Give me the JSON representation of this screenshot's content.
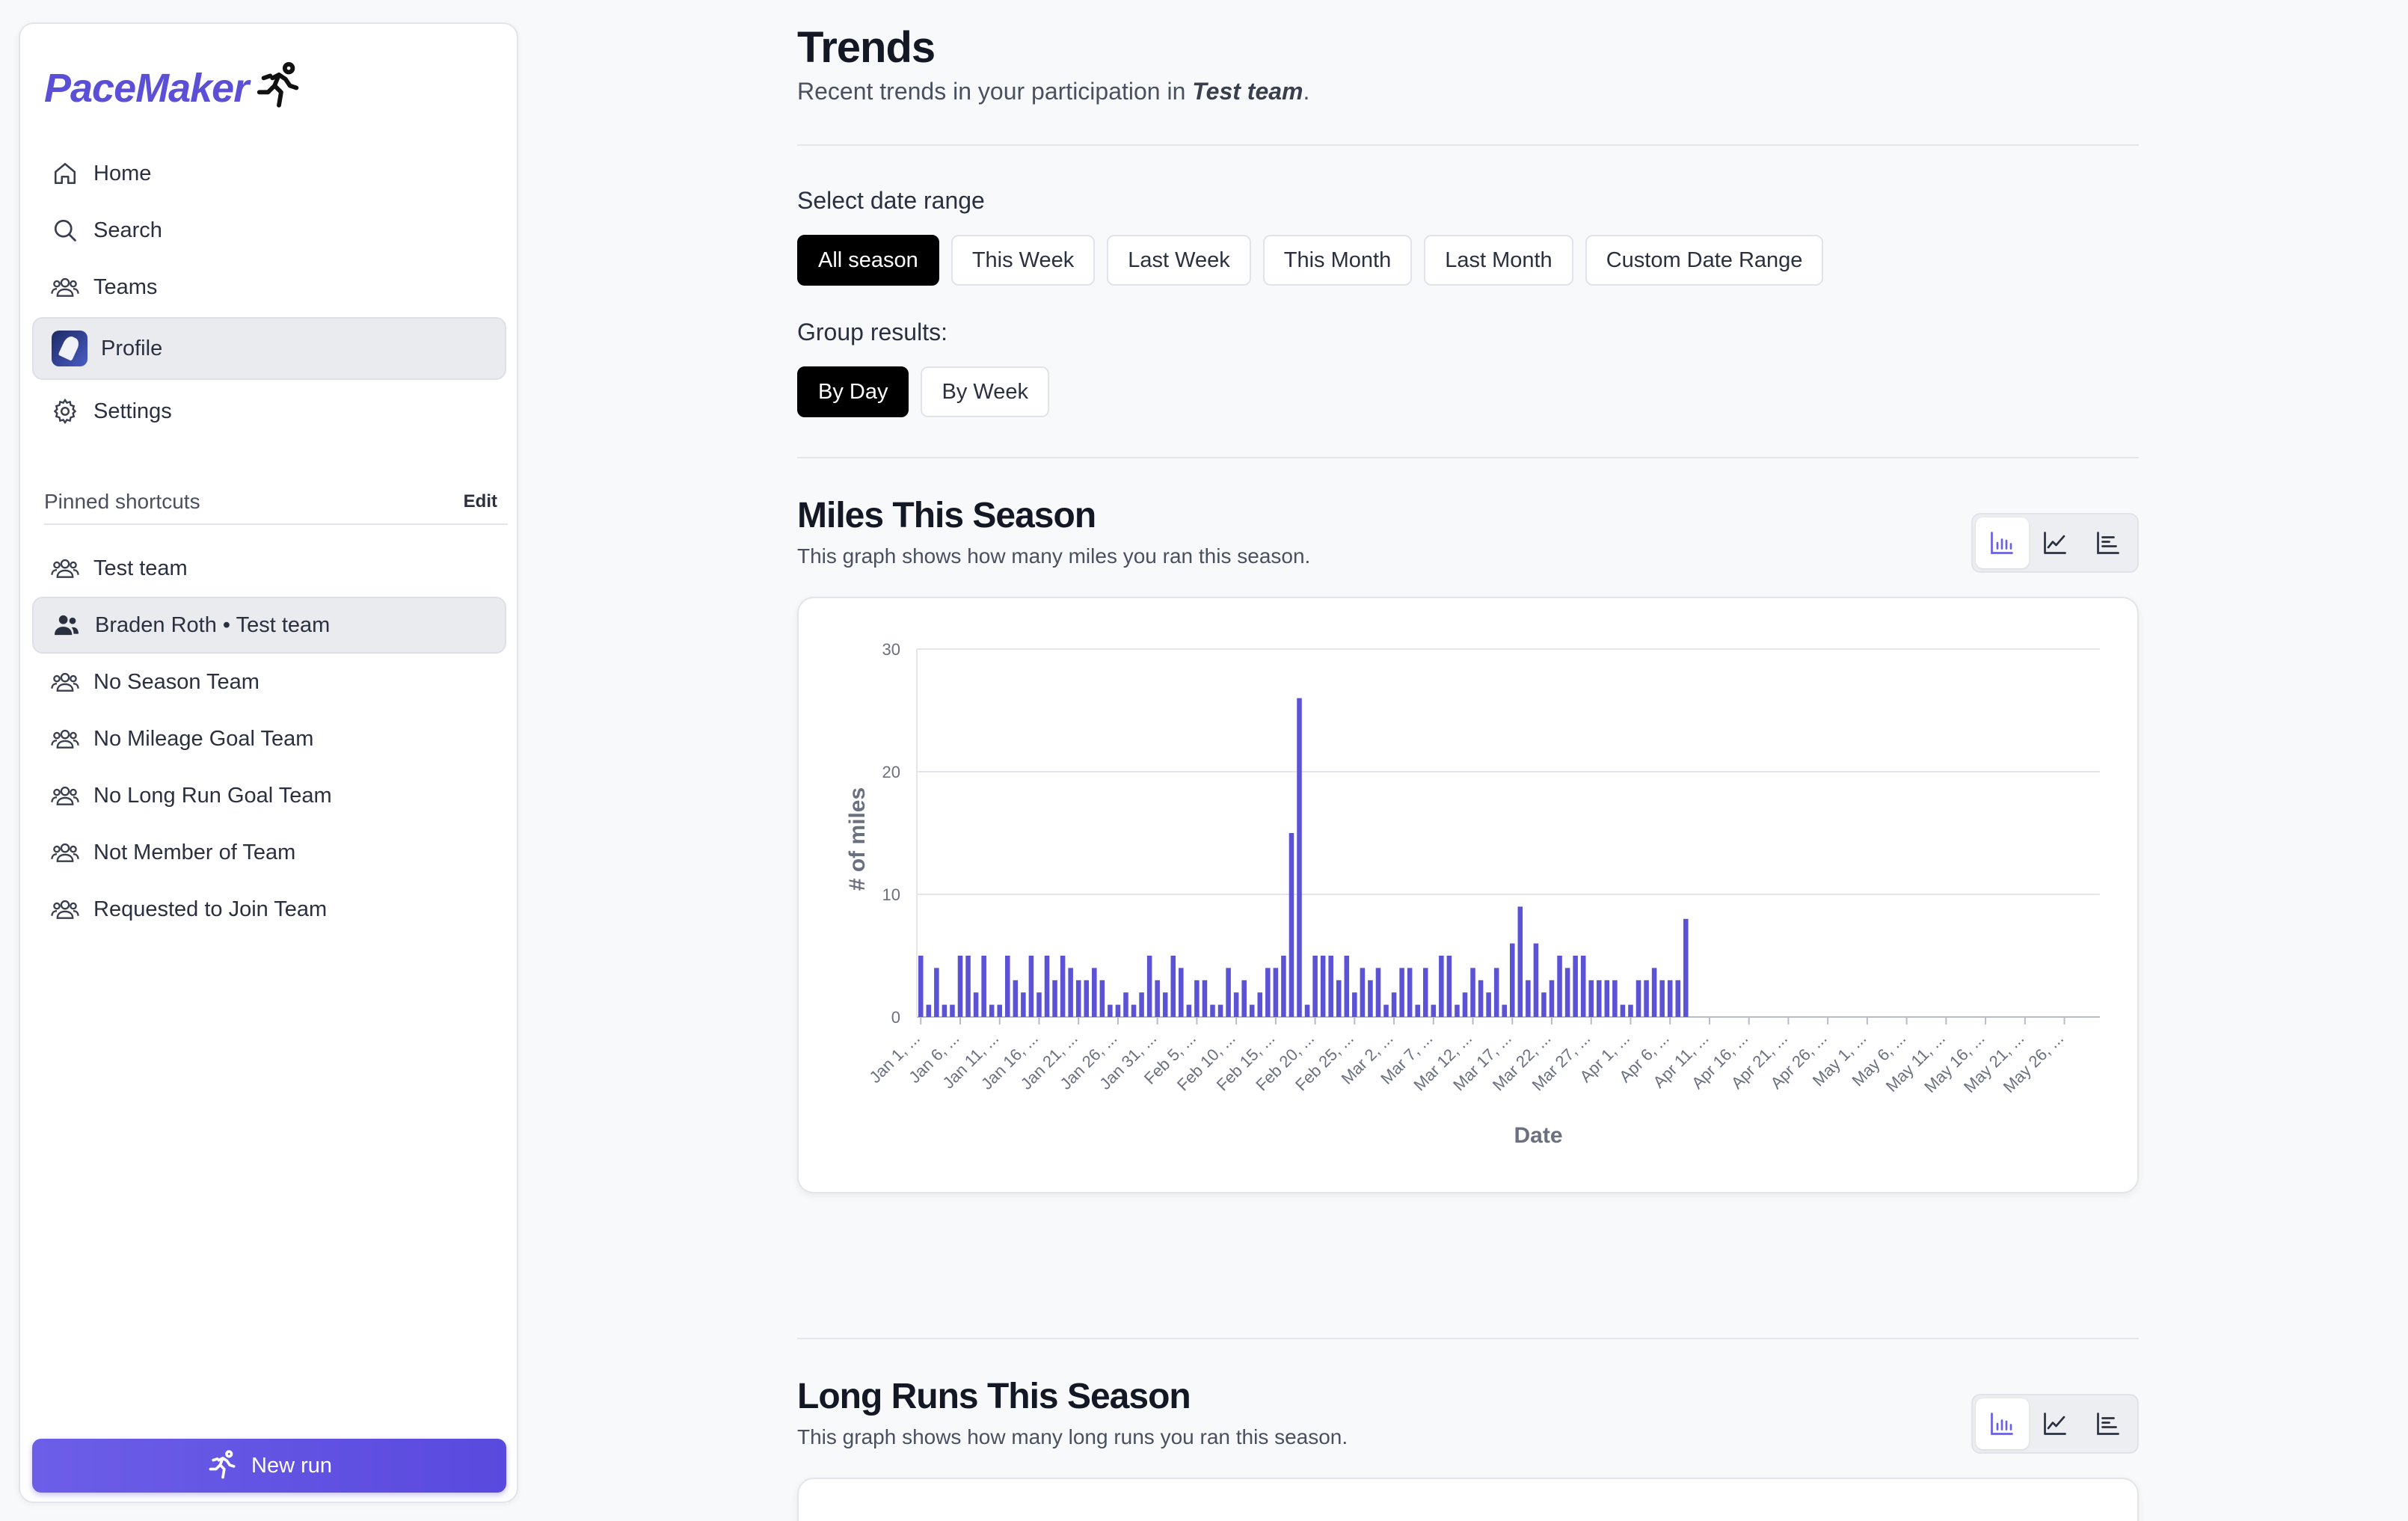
{
  "app": {
    "name": "PaceMaker"
  },
  "sidebar": {
    "nav": [
      {
        "label": "Home",
        "icon": "home-icon"
      },
      {
        "label": "Search",
        "icon": "search-icon"
      },
      {
        "label": "Teams",
        "icon": "users-icon"
      },
      {
        "label": "Profile",
        "icon": "avatar",
        "active": true
      },
      {
        "label": "Settings",
        "icon": "gear-icon"
      }
    ],
    "pinned_title": "Pinned shortcuts",
    "edit_label": "Edit",
    "pinned": [
      {
        "label": "Test team"
      },
      {
        "label": "Braden Roth • Test team",
        "active": true
      },
      {
        "label": "No Season Team"
      },
      {
        "label": "No Mileage Goal Team"
      },
      {
        "label": "No Long Run Goal Team"
      },
      {
        "label": "Not Member of Team"
      },
      {
        "label": "Requested to Join Team"
      }
    ],
    "new_run_label": "New run"
  },
  "page": {
    "title": "Trends",
    "subtitle_prefix": "Recent trends in your participation in ",
    "subtitle_team": "Test team",
    "subtitle_suffix": "."
  },
  "filters": {
    "date_range_label": "Select date range",
    "date_ranges": [
      "All season",
      "This Week",
      "Last Week",
      "This Month",
      "Last Month",
      "Custom Date Range"
    ],
    "date_range_selected": "All season",
    "group_label": "Group results:",
    "groups": [
      "By Day",
      "By Week"
    ],
    "group_selected": "By Day"
  },
  "sections": {
    "miles": {
      "title": "Miles This Season",
      "description": "This graph shows how many miles you ran this season."
    },
    "long_runs": {
      "title": "Long Runs This Season",
      "description": "This graph shows how many long runs you ran this season."
    }
  },
  "colors": {
    "accent": "#5b4fd8",
    "bar": "#5b52d6"
  },
  "chart_data": {
    "type": "bar",
    "xlabel": "Date",
    "ylabel": "# of miles",
    "ylim": [
      0,
      30
    ],
    "yticks": [
      0,
      10,
      20,
      30
    ],
    "grid": true,
    "tick_labels": [
      "Jan 1, ...",
      "Jan 6, ...",
      "Jan 11, ...",
      "Jan 16, ...",
      "Jan 21, ...",
      "Jan 26, ...",
      "Jan 31, ...",
      "Feb 5, ...",
      "Feb 10, ...",
      "Feb 15, ...",
      "Feb 20, ...",
      "Feb 25, ...",
      "Mar 2, ...",
      "Mar 7, ...",
      "Mar 12, ...",
      "Mar 17, ...",
      "Mar 22, ...",
      "Mar 27, ...",
      "Apr 1, ...",
      "Apr 6, ...",
      "Apr 11, ...",
      "Apr 16, ...",
      "Apr 21, ...",
      "Apr 26, ...",
      "May 1, ...",
      "May 6, ...",
      "May 11, ...",
      "May 16, ...",
      "May 21, ...",
      "May 26, ..."
    ],
    "values": [
      5,
      1,
      4,
      1,
      1,
      5,
      5,
      2,
      5,
      1,
      1,
      5,
      3,
      2,
      5,
      2,
      5,
      3,
      5,
      4,
      3,
      3,
      4,
      3,
      1,
      1,
      2,
      1,
      2,
      5,
      3,
      2,
      5,
      4,
      1,
      3,
      3,
      1,
      1,
      4,
      2,
      3,
      1,
      2,
      4,
      4,
      5,
      15,
      26,
      1,
      5,
      5,
      5,
      3,
      5,
      2,
      4,
      3,
      4,
      1,
      2,
      4,
      4,
      1,
      4,
      1,
      5,
      5,
      1,
      2,
      4,
      3,
      2,
      4,
      1,
      6,
      9,
      3,
      6,
      2,
      3,
      5,
      4,
      5,
      5,
      3,
      3,
      3,
      3,
      1,
      1,
      3,
      3,
      4,
      3,
      3,
      3,
      8,
      0,
      0,
      0,
      0,
      0,
      0,
      0,
      0,
      0,
      0,
      0,
      0,
      0,
      0,
      0,
      0,
      0,
      0,
      0,
      0,
      0,
      0,
      0,
      0,
      0,
      0,
      0,
      0,
      0,
      0,
      0,
      0,
      0,
      0,
      0,
      0,
      0,
      0,
      0,
      0,
      0,
      0,
      0,
      0,
      0,
      0,
      0,
      0,
      0,
      0,
      0,
      0
    ]
  }
}
